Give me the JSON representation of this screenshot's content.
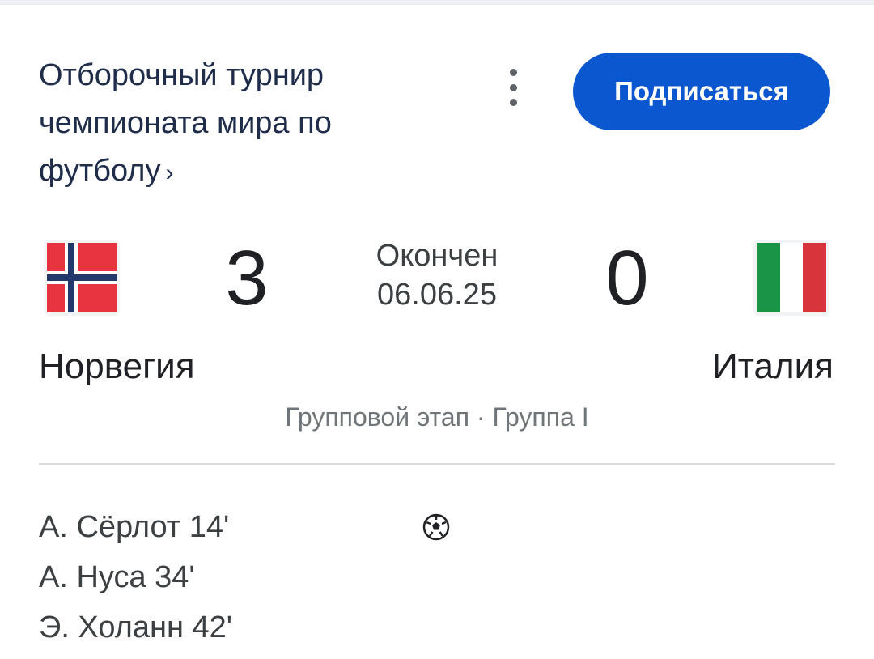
{
  "header": {
    "title_lines": [
      "Отборочный турнир",
      "чемпионата мира по",
      "футболу"
    ],
    "title_chevron": "›",
    "more_icon": "more-vertical-icon",
    "subscribe_label": "Подписаться",
    "accent_color": "#0b57d0"
  },
  "match": {
    "home": {
      "name": "Норвегия",
      "score": "3",
      "flag_icon": "norway-flag-icon"
    },
    "away": {
      "name": "Италия",
      "score": "0",
      "flag_icon": "italy-flag-icon"
    },
    "status": "Окончен",
    "date": "06.06.25",
    "stage": "Групповой этап · Группа I"
  },
  "goals": {
    "icon": "soccer-ball-icon",
    "home": [
      "А. Сёрлот 14'",
      "А. Нуса 34'",
      "Э. Холанн 42'"
    ]
  }
}
